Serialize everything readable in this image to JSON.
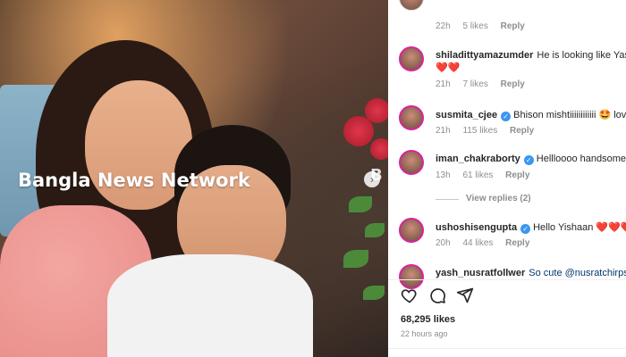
{
  "photo": {
    "watermark": "Bangla News Network",
    "watermark_partial": "B"
  },
  "comments": [
    {
      "user": "",
      "text": "",
      "time": "22h",
      "likes": "5 likes",
      "reply": "Reply"
    },
    {
      "user": "shiladittyamazumder",
      "verified": false,
      "text": "He is looking like Yash",
      "emoji": "❤️❤️",
      "time": "21h",
      "likes": "7 likes",
      "reply": "Reply"
    },
    {
      "user": "susmita_cjee",
      "verified": true,
      "text": "Bhison mishtiiiiiiiiiiii 🤩 lov",
      "time": "21h",
      "likes": "115 likes",
      "reply": "Reply"
    },
    {
      "user": "iman_chakraborty",
      "verified": true,
      "text": "Hellloooo handsome",
      "time": "13h",
      "likes": "61 likes",
      "reply": "Reply",
      "view_replies": "View replies (2)"
    },
    {
      "user": "ushoshisengupta",
      "verified": true,
      "text": "Hello Yishaan",
      "emoji": "❤️❤️❤️",
      "time": "20h",
      "likes": "44 likes",
      "reply": "Reply"
    },
    {
      "user": "yash_nusratfollwer",
      "verified": false,
      "text": "So cute @nusratchirps"
    }
  ],
  "footer": {
    "likes": "68,295 likes",
    "time_ago": "22 hours ago"
  },
  "icons": {
    "like": "heart-icon",
    "comment": "comment-icon",
    "share": "share-icon"
  },
  "colors": {
    "verified": "#3897f0",
    "story_ring": "#d6249f",
    "heart": "#ed2e44"
  }
}
